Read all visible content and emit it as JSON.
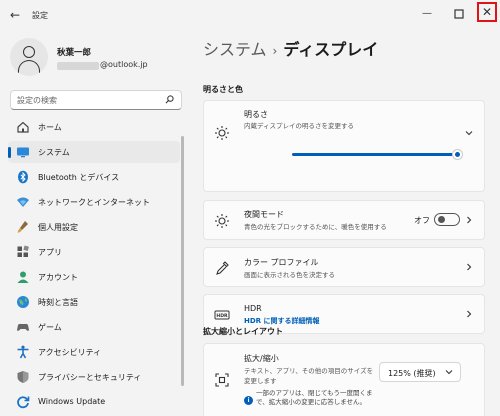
{
  "titlebar": {
    "app_title": "設定",
    "back_icon": "back-arrow-icon",
    "minimize_icon": "minimize-icon",
    "maximize_icon": "maximize-icon",
    "close_icon": "close-icon"
  },
  "profile": {
    "name": "秋葉一郎",
    "email_suffix": "@outlook.jp"
  },
  "search": {
    "placeholder": "設定の検索"
  },
  "nav": {
    "items": [
      {
        "label": "ホーム",
        "icon": "home-icon"
      },
      {
        "label": "システム",
        "icon": "system-icon",
        "active": true
      },
      {
        "label": "Bluetooth とデバイス",
        "icon": "bluetooth-icon"
      },
      {
        "label": "ネットワークとインターネット",
        "icon": "network-icon"
      },
      {
        "label": "個人用設定",
        "icon": "personalization-icon"
      },
      {
        "label": "アプリ",
        "icon": "apps-icon"
      },
      {
        "label": "アカウント",
        "icon": "accounts-icon"
      },
      {
        "label": "時刻と言語",
        "icon": "time-language-icon"
      },
      {
        "label": "ゲーム",
        "icon": "gaming-icon"
      },
      {
        "label": "アクセシビリティ",
        "icon": "accessibility-icon"
      },
      {
        "label": "プライバシーとセキュリティ",
        "icon": "privacy-icon"
      },
      {
        "label": "Windows Update",
        "icon": "windows-update-icon"
      }
    ]
  },
  "main": {
    "breadcrumb_parent": "システム",
    "breadcrumb_sep": "›",
    "breadcrumb_current": "ディスプレイ",
    "section_brightness": "明るさと色",
    "brightness": {
      "title": "明るさ",
      "subtitle": "内蔵ディスプレイの明るさを変更する",
      "value_fraction": 0.97
    },
    "night_light": {
      "title": "夜間モード",
      "subtitle": "青色の光をブロックするために、暖色を使用する",
      "state": "オフ"
    },
    "color_profile": {
      "title": "カラー プロファイル",
      "subtitle": "画面に表示される色を決定する"
    },
    "hdr": {
      "title": "HDR",
      "link": "HDR に関する詳細情報"
    },
    "section_scale": "拡大縮小とレイアウト",
    "scale": {
      "title": "拡大/縮小",
      "subtitle_1": "テキスト、アプリ、その他の項目のサイズを",
      "subtitle_2": "変更します",
      "dropdown_value": "125% (推奨)",
      "info_text": "一部のアプリは、閉じてもう一度開くまで、拡大縮小の変更に応答しません。"
    }
  }
}
